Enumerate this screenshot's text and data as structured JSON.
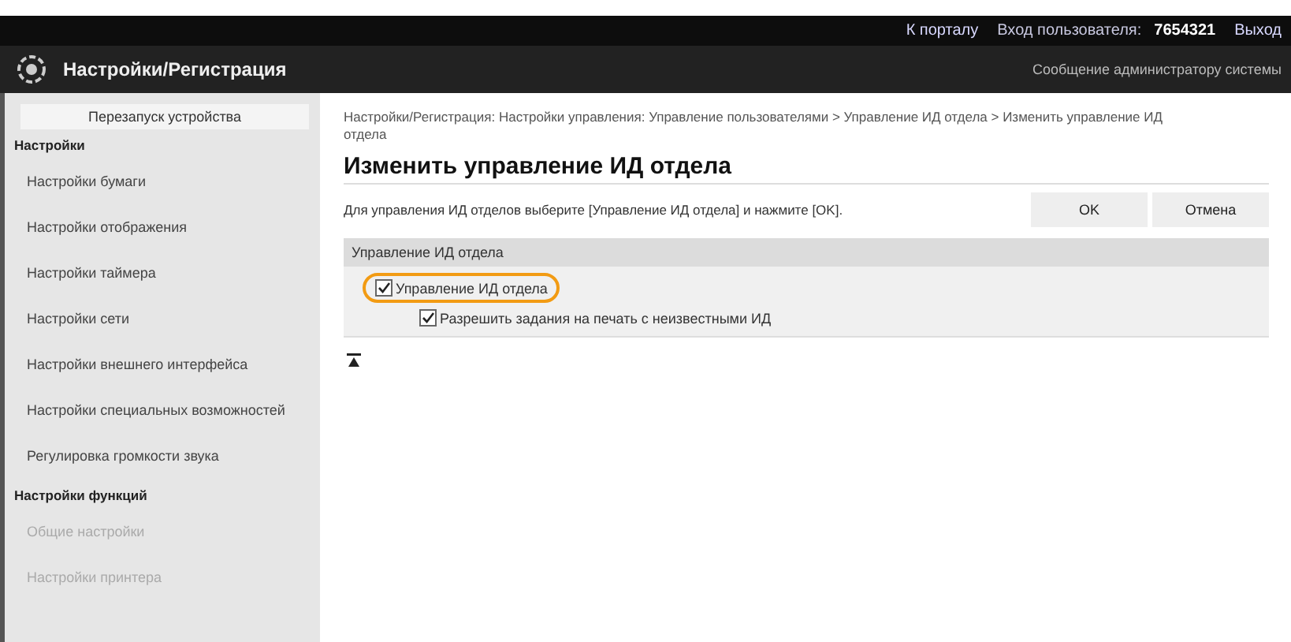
{
  "top_bar": {
    "links": [
      {
        "label": "К порталу",
        "kind": "link"
      },
      {
        "label": "Вход пользователя:",
        "kind": "text"
      },
      {
        "label": "7654321",
        "kind": "strong"
      },
      {
        "label": "Выход",
        "kind": "link"
      }
    ]
  },
  "header": {
    "title": "Настройки/Регистрация",
    "message_link": "Сообщение администратору системы"
  },
  "sidebar": {
    "restart_button": "Перезапуск устройства",
    "sections": [
      {
        "title": "Настройки",
        "items": [
          {
            "label": "Настройки бумаги",
            "faded": false
          },
          {
            "label": "Настройки отображения",
            "faded": false
          },
          {
            "label": "Настройки таймера",
            "faded": false
          },
          {
            "label": "Настройки сети",
            "faded": false
          },
          {
            "label": "Настройки внешнего интерфейса",
            "faded": false
          },
          {
            "label": "Настройки специальных возможностей",
            "faded": false
          },
          {
            "label": "Регулировка громкости звука",
            "faded": false
          }
        ]
      },
      {
        "title": "Настройки функций",
        "items": [
          {
            "label": "Общие настройки",
            "faded": true
          },
          {
            "label": "Настройки принтера",
            "faded": true
          }
        ]
      }
    ]
  },
  "breadcrumb": "Настройки/Регистрация: Настройки управления: Управление пользователями > Управление ИД отдела > Изменить управление ИД отдела",
  "page_title": "Изменить управление ИД отдела",
  "instruction": "Для управления ИД отделов выберите [Управление ИД отдела] и нажмите [OK].",
  "buttons": [
    {
      "label": "OK"
    },
    {
      "label": "Отмена"
    }
  ],
  "section": {
    "title": "Управление ИД отдела",
    "options": [
      {
        "label": "Управление ИД отдела",
        "checked": true,
        "highlighted": true,
        "children": [
          {
            "label": "Разрешить задания на печать с неизвестными ИД",
            "checked": true,
            "highlighted": false
          }
        ]
      }
    ]
  }
}
